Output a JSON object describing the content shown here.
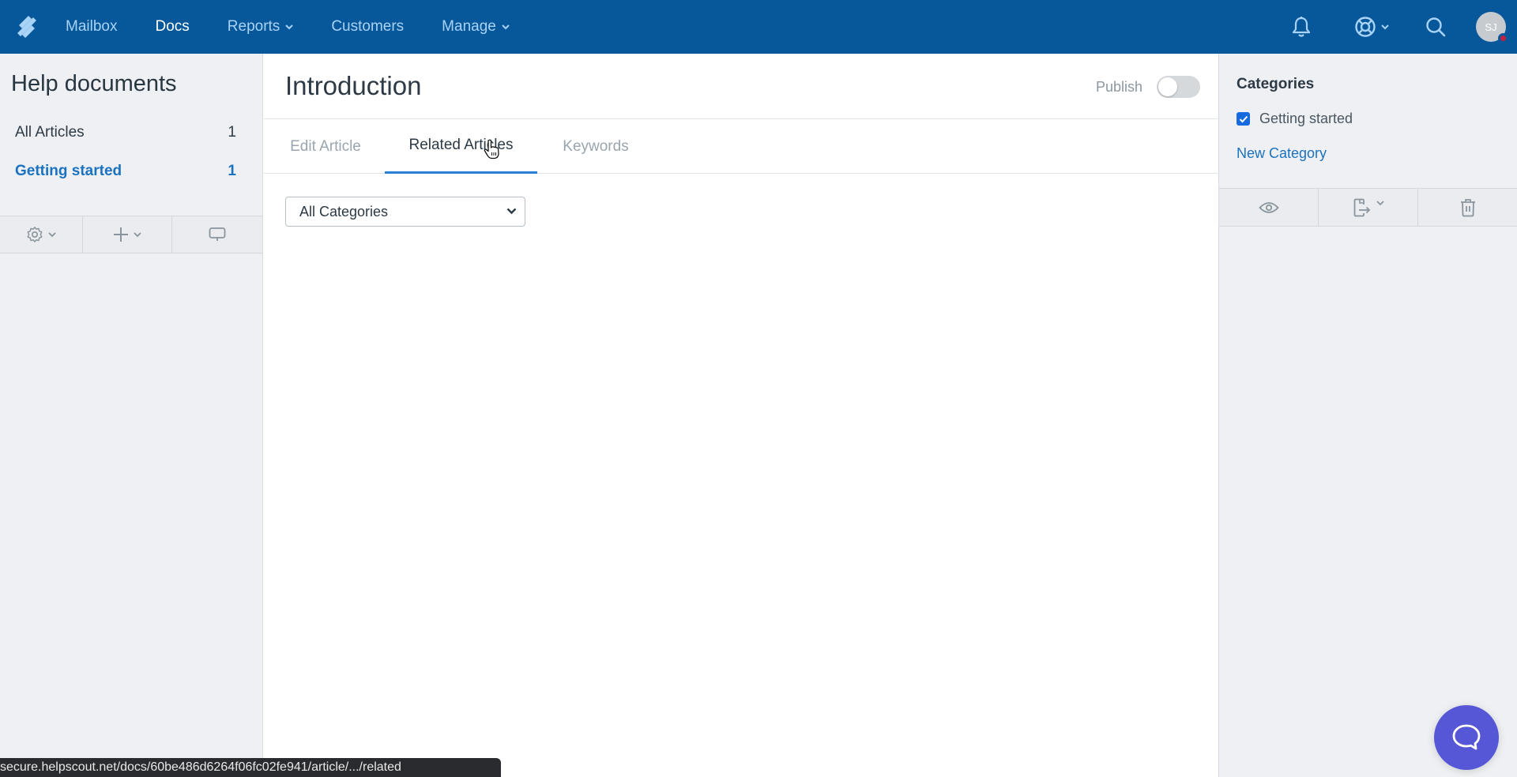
{
  "topnav": {
    "logo": "helpscout-logo-icon",
    "items": [
      {
        "label": "Mailbox",
        "active": false,
        "dropdown": false
      },
      {
        "label": "Docs",
        "active": true,
        "dropdown": false
      },
      {
        "label": "Reports",
        "active": false,
        "dropdown": true
      },
      {
        "label": "Customers",
        "active": false,
        "dropdown": false
      },
      {
        "label": "Manage",
        "active": false,
        "dropdown": true
      }
    ],
    "right_icons": [
      "bell-icon",
      "lifebuoy-icon",
      "search-icon"
    ],
    "avatar_initials": "SJ",
    "colors": {
      "bar": "#07589b",
      "link": "#a9d2f7",
      "active": "#ffffff"
    }
  },
  "sidebar": {
    "title": "Help documents",
    "items": [
      {
        "label": "All Articles",
        "count": "1",
        "active": false
      },
      {
        "label": "Getting started",
        "count": "1",
        "active": true
      }
    ],
    "toolbar": [
      "gear-icon",
      "plus-icon",
      "monitor-icon"
    ]
  },
  "main": {
    "title": "Introduction",
    "publish_label": "Publish",
    "publish_on": false,
    "tabs": [
      {
        "label": "Edit Article",
        "active": false
      },
      {
        "label": "Related Articles",
        "active": true
      },
      {
        "label": "Keywords",
        "active": false
      }
    ],
    "category_select": {
      "selected": "All Categories"
    }
  },
  "right_sidebar": {
    "title": "Categories",
    "categories": [
      {
        "label": "Getting started",
        "checked": true
      }
    ],
    "new_category_label": "New Category",
    "toolbar": [
      "eye-icon",
      "export-icon",
      "trash-icon"
    ]
  },
  "statusbar": {
    "url": "secure.helpscout.net/docs/60be486d6264f06fc02fe941/article/.../related"
  },
  "beacon": {
    "icon": "chat-bubble-icon",
    "color": "#5657d6"
  }
}
